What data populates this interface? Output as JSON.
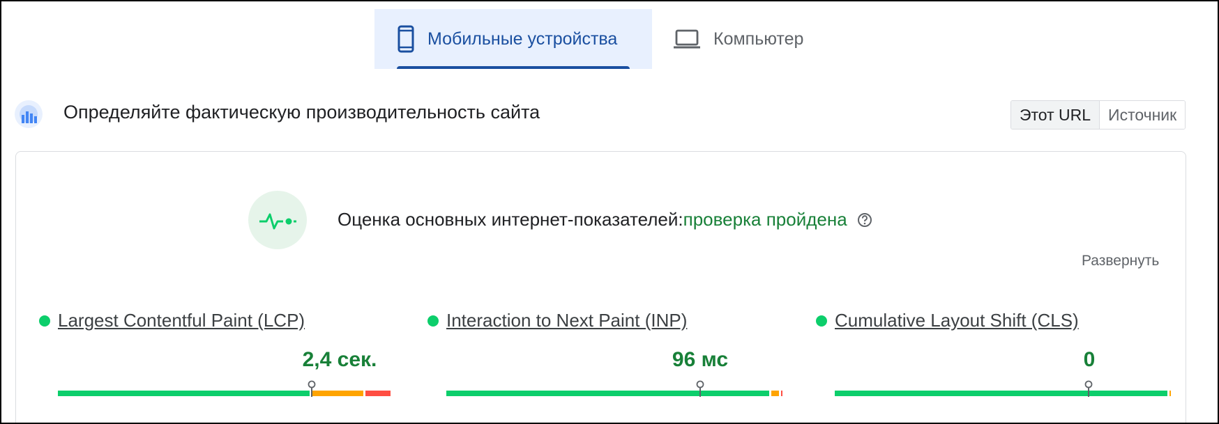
{
  "tabs": [
    {
      "label": "Мобильные устройства",
      "icon": "smartphone-icon",
      "active": true
    },
    {
      "label": "Компьютер",
      "icon": "laptop-icon",
      "active": false
    }
  ],
  "header": {
    "title": "Определяйте фактическую производительность сайта",
    "toggle": [
      {
        "label": "Этот URL",
        "active": true
      },
      {
        "label": "Источник",
        "active": false
      }
    ]
  },
  "assessment": {
    "label": "Оценка основных интернет-показателей:",
    "status": "проверка пройдена",
    "expand_label": "Развернуть"
  },
  "metrics": [
    {
      "name": "Largest Contentful Paint (LCP)",
      "value": "2,4 сек.",
      "distribution": {
        "good": 0.75,
        "needs_improvement": 0.16,
        "poor": 0.08
      },
      "marker": 0.75
    },
    {
      "name": "Interaction to Next Paint (INP)",
      "value": "96 мс",
      "distribution": {
        "good": 0.96,
        "needs_improvement": 0.03,
        "poor": 0.01
      },
      "marker": 0.75
    },
    {
      "name": "Cumulative Layout Shift (CLS)",
      "value": "0",
      "distribution": {
        "good": 0.99,
        "needs_improvement": 0.01,
        "poor": 0.0
      },
      "marker": 0.75
    }
  ],
  "colors": {
    "good": "#0cce6b",
    "needs_improvement": "#ffa400",
    "poor": "#ff4e42",
    "active_tab": "#1a4fa0",
    "pass_text": "#188038"
  }
}
